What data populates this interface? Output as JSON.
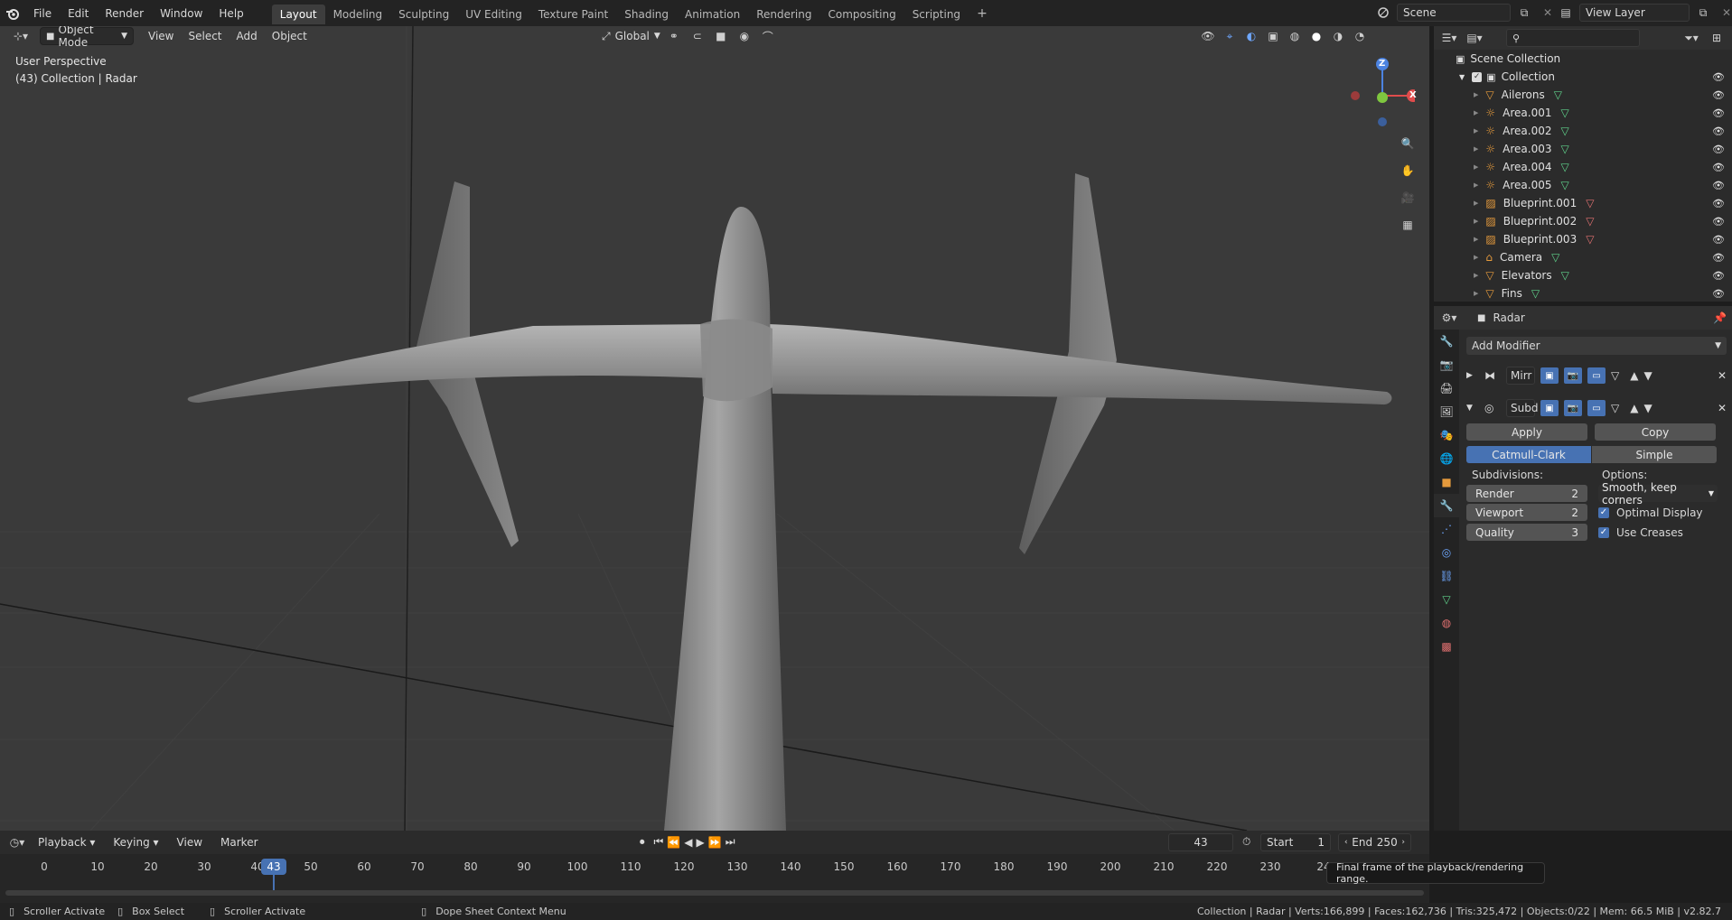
{
  "topbar": {
    "menus": [
      "File",
      "Edit",
      "Render",
      "Window",
      "Help"
    ],
    "workspaces": [
      "Layout",
      "Modeling",
      "Sculpting",
      "UV Editing",
      "Texture Paint",
      "Shading",
      "Animation",
      "Rendering",
      "Compositing",
      "Scripting"
    ],
    "active_workspace": "Layout",
    "add_tab": "+",
    "scene": "Scene",
    "view_layer": "View Layer"
  },
  "viewport": {
    "mode": "Object Mode",
    "menus": [
      "View",
      "Select",
      "Add",
      "Object"
    ],
    "transform_orientation": "Global",
    "overlay_title": "User Perspective",
    "overlay_subtitle": "(43) Collection | Radar",
    "gizmo": {
      "z": "Z",
      "x": "X"
    }
  },
  "outliner": {
    "search_placeholder": "",
    "root": "Scene Collection",
    "collection": "Collection",
    "items": [
      {
        "name": "Ailerons",
        "type": "mesh"
      },
      {
        "name": "Area.001",
        "type": "light"
      },
      {
        "name": "Area.002",
        "type": "light"
      },
      {
        "name": "Area.003",
        "type": "light"
      },
      {
        "name": "Area.004",
        "type": "light"
      },
      {
        "name": "Area.005",
        "type": "light"
      },
      {
        "name": "Blueprint.001",
        "type": "image"
      },
      {
        "name": "Blueprint.002",
        "type": "image"
      },
      {
        "name": "Blueprint.003",
        "type": "image"
      },
      {
        "name": "Camera",
        "type": "camera"
      },
      {
        "name": "Elevators",
        "type": "mesh"
      },
      {
        "name": "Fins",
        "type": "mesh"
      }
    ]
  },
  "properties": {
    "object_name": "Radar",
    "add_modifier": "Add Modifier",
    "modifiers": [
      {
        "name": "Mirr",
        "expanded": false
      },
      {
        "name": "Subd",
        "expanded": true
      }
    ],
    "apply": "Apply",
    "copy": "Copy",
    "algo_catmull": "Catmull-Clark",
    "algo_simple": "Simple",
    "subdivisions_label": "Subdivisions:",
    "options_label": "Options:",
    "render_label": "Render",
    "render_value": "2",
    "viewport_label": "Viewport",
    "viewport_value": "2",
    "quality_label": "Quality",
    "quality_value": "3",
    "uv_smooth": "Smooth, keep corners",
    "optimal_display": "Optimal Display",
    "use_creases": "Use Creases"
  },
  "timeline": {
    "menus": [
      "Playback",
      "Keying",
      "View",
      "Marker"
    ],
    "current_frame": "43",
    "start_label": "Start",
    "start_value": "1",
    "end_label": "End",
    "end_value": "250",
    "ticks": [
      "0",
      "10",
      "20",
      "30",
      "40",
      "50",
      "60",
      "70",
      "80",
      "90",
      "100",
      "110",
      "120",
      "130",
      "140",
      "150",
      "160",
      "170",
      "180",
      "190",
      "200",
      "210",
      "220",
      "230",
      "24"
    ],
    "playhead": "43",
    "tooltip": "Final frame of the playback/rendering range."
  },
  "statusbar": {
    "items": [
      "Scroller Activate",
      "Box Select",
      "Scroller Activate",
      "Dope Sheet Context Menu"
    ],
    "stats": "Collection | Radar | Verts:166,899 | Faces:162,736 | Tris:325,472 | Objects:0/22 | Mem: 66.5 MiB | v2.82.7"
  },
  "colors": {
    "accent": "#4772b3",
    "bg_viewport": "#3a3a3a",
    "panel": "#2b2b2b"
  }
}
